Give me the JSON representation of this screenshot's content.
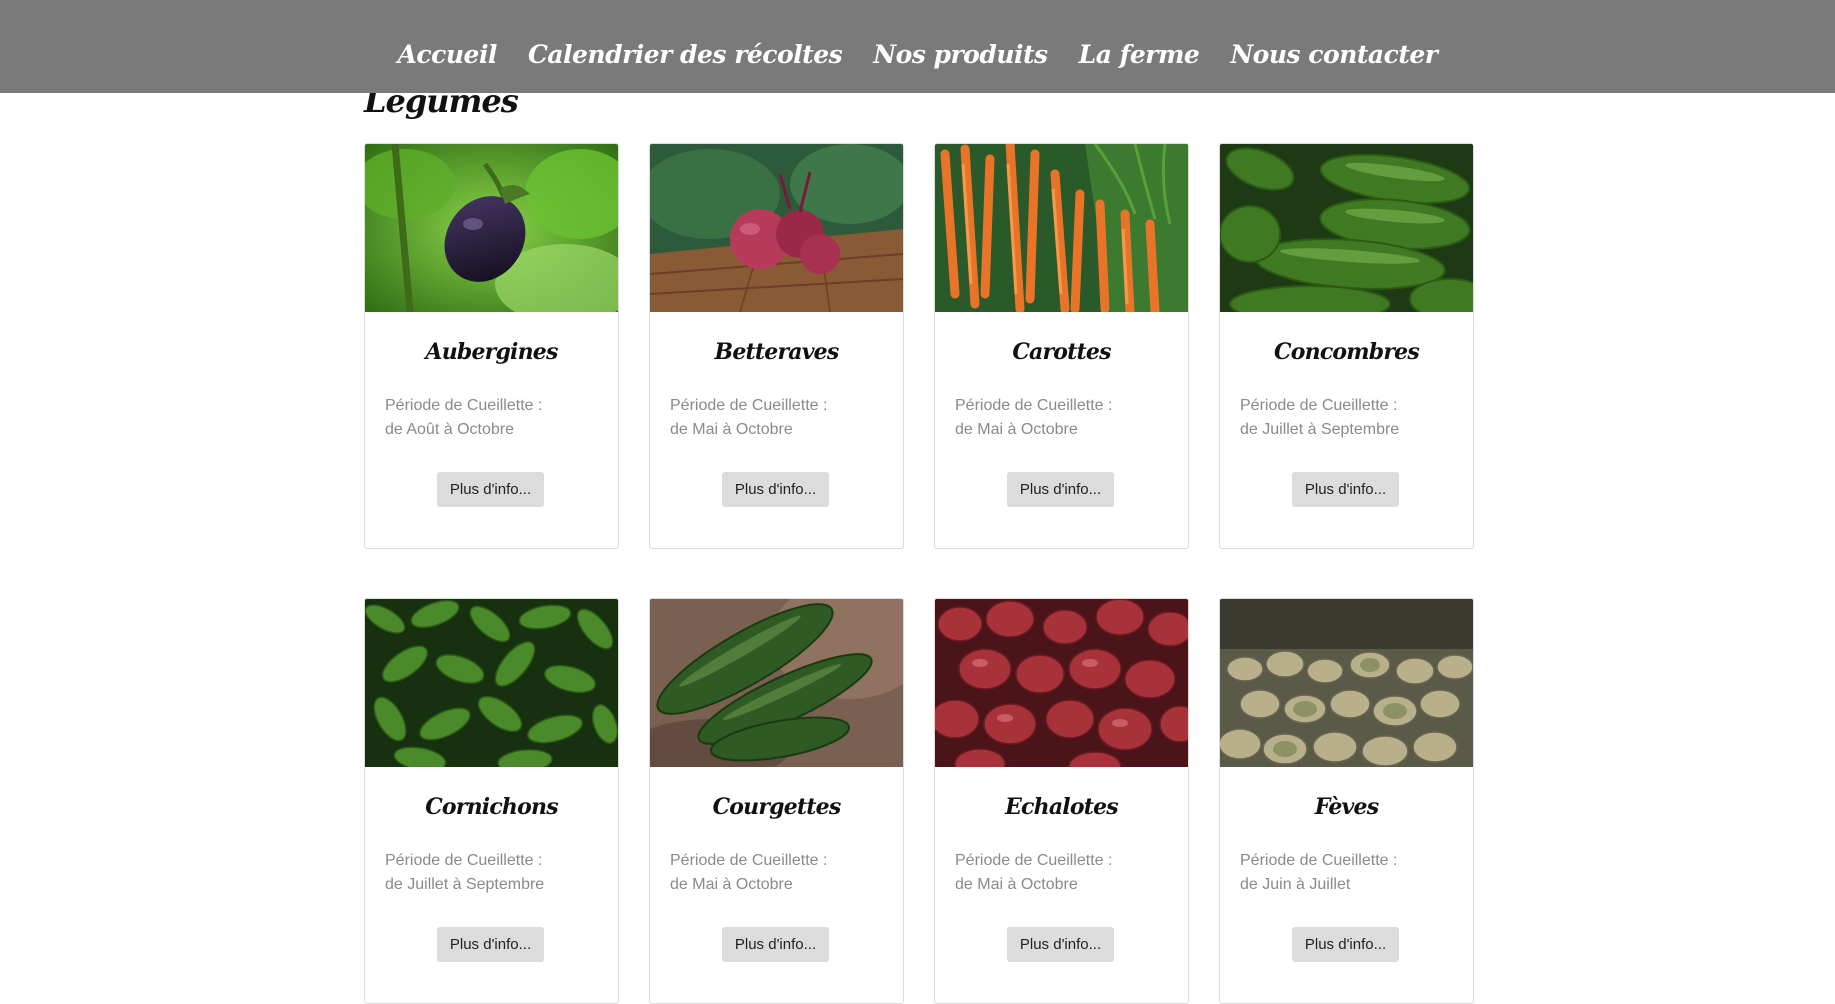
{
  "nav": {
    "items": [
      "Accueil",
      "Calendrier des récoltes",
      "Nos produits",
      "La ferme",
      "Nous contacter"
    ]
  },
  "section": {
    "title": "Légumes"
  },
  "cards": [
    {
      "name": "Aubergines",
      "period_label": "Période de Cueillette :",
      "period": "de Août à Octobre",
      "button": "Plus d'info..."
    },
    {
      "name": "Betteraves",
      "period_label": "Période de Cueillette :",
      "period": "de Mai à Octobre",
      "button": "Plus d'info..."
    },
    {
      "name": "Carottes",
      "period_label": "Période de Cueillette :",
      "period": "de Mai à Octobre",
      "button": "Plus d'info..."
    },
    {
      "name": "Concombres",
      "period_label": "Période de Cueillette :",
      "period": "de Juillet à Septembre",
      "button": "Plus d'info..."
    },
    {
      "name": "Cornichons",
      "period_label": "Période de Cueillette :",
      "period": "de Juillet à Septembre",
      "button": "Plus d'info..."
    },
    {
      "name": "Courgettes",
      "period_label": "Période de Cueillette :",
      "period": "de Mai à Octobre",
      "button": "Plus d'info..."
    },
    {
      "name": "Echalotes",
      "period_label": "Période de Cueillette :",
      "period": "de Mai à Octobre",
      "button": "Plus d'info..."
    },
    {
      "name": "Fèves",
      "period_label": "Période de Cueillette :",
      "period": "de Juin à Juillet",
      "button": "Plus d'info..."
    }
  ],
  "colors": {
    "navbar_bg": "#7a7a7a",
    "nav_text": "#ffffff",
    "card_border": "#dcdcdc",
    "period_text": "#8a8a8a",
    "button_bg": "#dcdcdc"
  }
}
